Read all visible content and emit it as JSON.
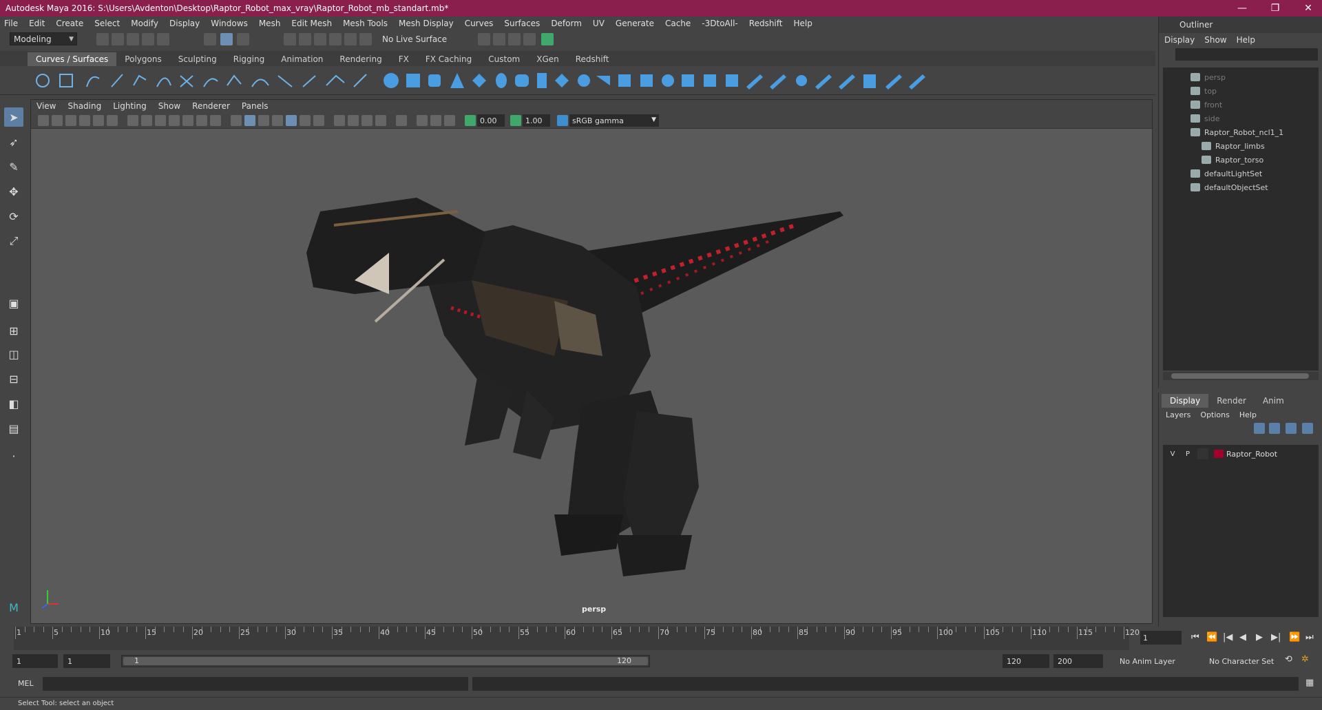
{
  "window": {
    "title": "Autodesk Maya 2016: S:\\Users\\Avdenton\\Desktop\\Raptor_Robot_max_vray\\Raptor_Robot_mb_standart.mb*",
    "min": "—",
    "max": "❐",
    "close": "✕"
  },
  "menubar": [
    "File",
    "Edit",
    "Create",
    "Select",
    "Modify",
    "Display",
    "Windows",
    "Mesh",
    "Edit Mesh",
    "Mesh Tools",
    "Mesh Display",
    "Curves",
    "Surfaces",
    "Deform",
    "UV",
    "Generate",
    "Cache",
    "-3DtoAll-",
    "Redshift",
    "Help"
  ],
  "statusline": {
    "mode": "Modeling",
    "live_surface": "No Live Surface"
  },
  "shelf_tabs": [
    "Curves / Surfaces",
    "Polygons",
    "Sculpting",
    "Rigging",
    "Animation",
    "Rendering",
    "FX",
    "FX Caching",
    "Custom",
    "XGen",
    "Redshift"
  ],
  "shelf_active": "Curves / Surfaces",
  "viewport": {
    "menu": [
      "View",
      "Shading",
      "Lighting",
      "Show",
      "Renderer",
      "Panels"
    ],
    "exposure": "0.00",
    "gamma": "1.00",
    "color_space": "sRGB gamma",
    "camera_label": "persp"
  },
  "outliner": {
    "title": "Outliner",
    "menu": [
      "Display",
      "Show",
      "Help"
    ],
    "items": [
      {
        "label": "persp",
        "dim": true,
        "indent": 1
      },
      {
        "label": "top",
        "dim": true,
        "indent": 1
      },
      {
        "label": "front",
        "dim": true,
        "indent": 1
      },
      {
        "label": "side",
        "dim": true,
        "indent": 1
      },
      {
        "label": "Raptor_Robot_ncl1_1",
        "dim": false,
        "indent": 1
      },
      {
        "label": "Raptor_limbs",
        "dim": false,
        "indent": 2
      },
      {
        "label": "Raptor_torso",
        "dim": false,
        "indent": 2
      },
      {
        "label": "defaultLightSet",
        "dim": false,
        "indent": 1
      },
      {
        "label": "defaultObjectSet",
        "dim": false,
        "indent": 1
      }
    ]
  },
  "layer_editor": {
    "tabs": [
      "Display",
      "Render",
      "Anim"
    ],
    "menu": [
      "Layers",
      "Options",
      "Help"
    ],
    "layer": {
      "v": "V",
      "p": "P",
      "name": "Raptor_Robot",
      "color": "#a5002a"
    }
  },
  "timeline": {
    "labels": [
      "1",
      "5",
      "10",
      "15",
      "20",
      "25",
      "30",
      "35",
      "40",
      "45",
      "50",
      "55",
      "60",
      "65",
      "70",
      "75",
      "80",
      "85",
      "90",
      "95",
      "100",
      "105",
      "110",
      "115",
      "120"
    ],
    "current_frame": "1"
  },
  "range": {
    "start": "1",
    "playback_start": "1",
    "range_start_label": "1",
    "range_end_label": "120",
    "playback_end": "120",
    "end": "200",
    "anim_layer": "No Anim Layer",
    "character_set": "No Character Set"
  },
  "command_line": {
    "label": "MEL"
  },
  "help_line": "Select Tool: select an object"
}
